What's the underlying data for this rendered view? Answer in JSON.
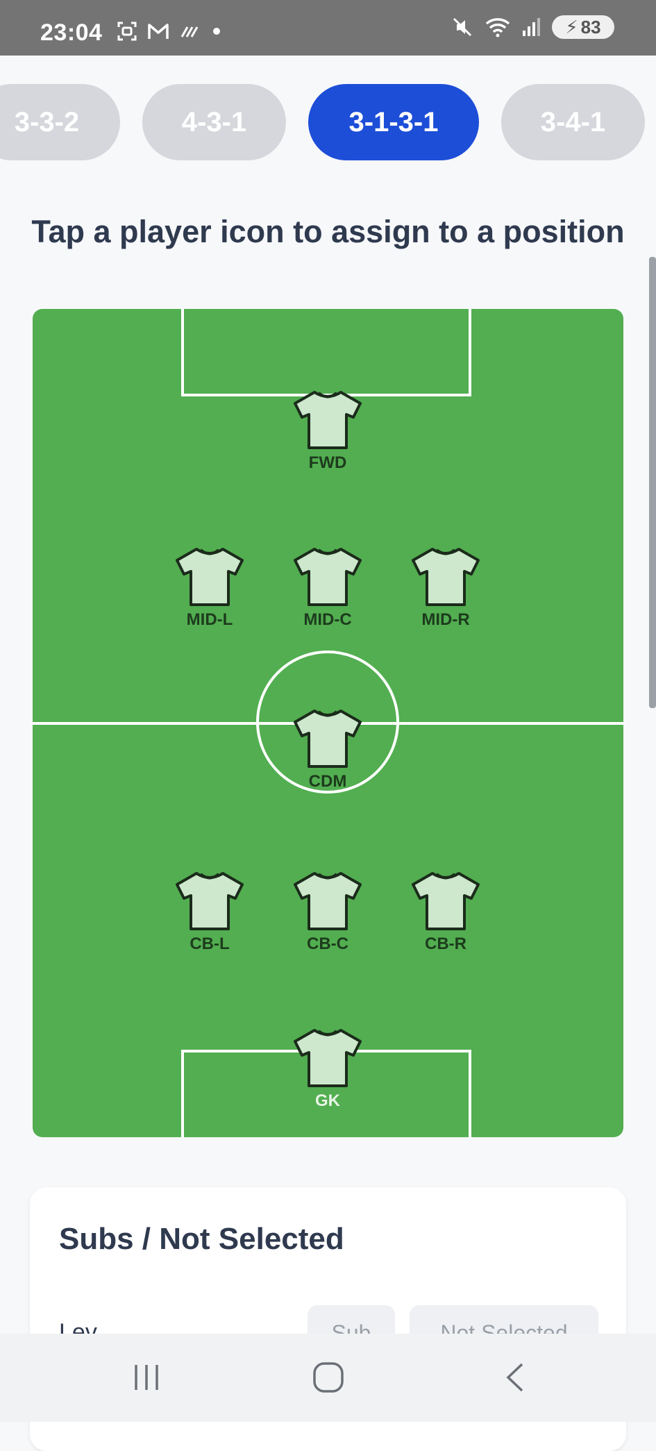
{
  "status_bar": {
    "time": "23:04",
    "battery": "83",
    "icons": [
      "screenshot-icon",
      "gmail-icon",
      "data-icon",
      "dot-icon",
      "mute-icon",
      "wifi-icon",
      "signal-icon",
      "battery-icon"
    ]
  },
  "formations": [
    {
      "label": "3-3-2",
      "selected": false
    },
    {
      "label": "4-3-1",
      "selected": false
    },
    {
      "label": "3-1-3-1",
      "selected": true
    },
    {
      "label": "3-4-1",
      "selected": false
    }
  ],
  "instruction": "Tap a player icon to assign to a position",
  "positions": [
    {
      "label": "FWD"
    },
    {
      "label": "MID-L"
    },
    {
      "label": "MID-C"
    },
    {
      "label": "MID-R"
    },
    {
      "label": "CDM"
    },
    {
      "label": "CB-L"
    },
    {
      "label": "CB-C"
    },
    {
      "label": "CB-R"
    },
    {
      "label": "GK"
    }
  ],
  "colors": {
    "pitch": "#52ae50",
    "accent": "#1d4ed8",
    "chip": "#d5d7dc",
    "jersey_fill": "#cde8cc",
    "jersey_stroke": "#1b2b1b"
  },
  "subs": {
    "title": "Subs / Not Selected",
    "row_name": "Lev",
    "sub_label": "Sub",
    "not_selected_label": "Not Selected"
  },
  "nav": {
    "icons": [
      "recents-icon",
      "home-icon",
      "back-icon"
    ]
  }
}
